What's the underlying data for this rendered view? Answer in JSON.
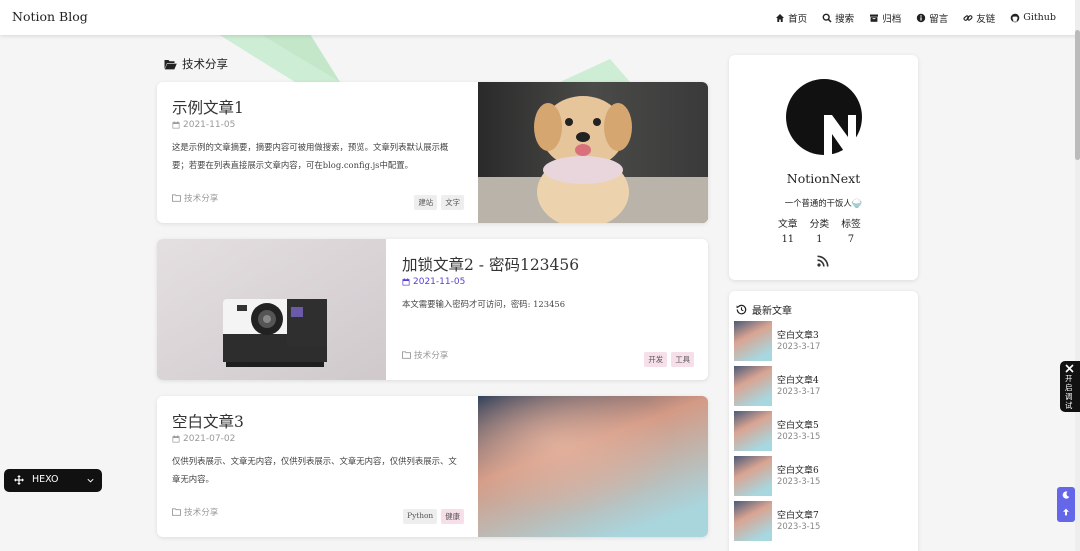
{
  "site": {
    "brand": "Notion Blog"
  },
  "nav": [
    {
      "label": "首页",
      "icon": "home-icon"
    },
    {
      "label": "搜索",
      "icon": "search-icon"
    },
    {
      "label": "归档",
      "icon": "archive-icon"
    },
    {
      "label": "留言",
      "icon": "info-icon"
    },
    {
      "label": "友链",
      "icon": "link-icon"
    },
    {
      "label": "Github",
      "icon": "github-icon"
    }
  ],
  "section": {
    "title": "技术分享",
    "icon": "folder-open-icon"
  },
  "posts": [
    {
      "title": "示例文章1",
      "date": "2021-11-05",
      "summary": "这是示例的文章摘要，摘要内容可被用做搜索，预览。文章列表默认展示概要；若要在列表直接展示文章内容，可在blog.config.js中配置。",
      "category": "技术分享",
      "tags": [
        "建站",
        "文字"
      ],
      "image": "golden-retriever-puppy-photo"
    },
    {
      "title": "加锁文章2 - 密码123456",
      "date": "2021-11-05",
      "summary": "本文需要输入密码才可访问，密码: 123456",
      "category": "技术分享",
      "tags": [
        "开发",
        "工具"
      ],
      "image": "polaroid-camera-photo"
    },
    {
      "title": "空白文章3",
      "date": "2021-07-02",
      "summary": "仅供列表展示、文章无内容，仅供列表展示、文章无内容，仅供列表展示、文章无内容。",
      "category": "技术分享",
      "tags": [
        "Python",
        "健康"
      ],
      "image": "gradient-blur-image"
    }
  ],
  "profile": {
    "name": "NotionNext",
    "bio": "一个普通的干饭人🍚",
    "stats": [
      {
        "label": "文章",
        "value": "11"
      },
      {
        "label": "分类",
        "value": "1"
      },
      {
        "label": "标签",
        "value": "7"
      }
    ],
    "rss_icon": "rss-icon"
  },
  "recent": {
    "title": "最新文章",
    "items": [
      {
        "title": "空白文章3",
        "date": "2023-3-17"
      },
      {
        "title": "空白文章4",
        "date": "2023-3-17"
      },
      {
        "title": "空白文章5",
        "date": "2023-3-15"
      },
      {
        "title": "空白文章6",
        "date": "2023-3-15"
      },
      {
        "title": "空白文章7",
        "date": "2023-3-15"
      }
    ]
  },
  "theme_switch": {
    "label": "HEXO"
  },
  "debug_button": {
    "label": "开启调试"
  },
  "colors": {
    "accent": "#5b3fd1",
    "tools": "#6367e8",
    "pink_tag": "#f6dfe8"
  }
}
